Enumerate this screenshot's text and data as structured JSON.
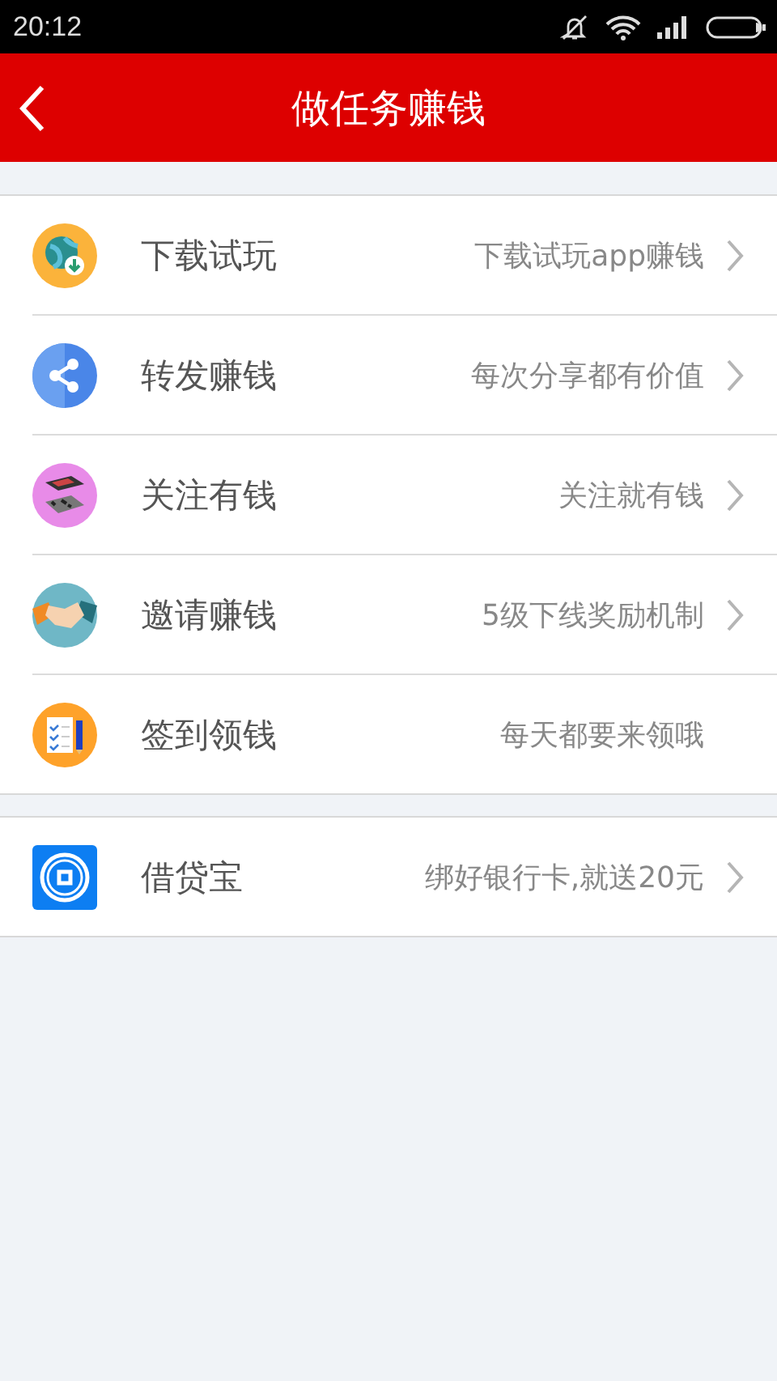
{
  "status_bar": {
    "time": "20:12"
  },
  "header": {
    "title": "做任务赚钱"
  },
  "sections": [
    {
      "items": [
        {
          "kind": "download",
          "label": "下载试玩",
          "detail": "下载试玩app赚钱",
          "has_arrow": true
        },
        {
          "kind": "share",
          "label": "转发赚钱",
          "detail": "每次分享都有价值",
          "has_arrow": true
        },
        {
          "kind": "follow",
          "label": "关注有钱",
          "detail": "关注就有钱",
          "has_arrow": true
        },
        {
          "kind": "invite",
          "label": "邀请赚钱",
          "detail": "5级下线奖励机制",
          "has_arrow": true
        },
        {
          "kind": "signin",
          "label": "签到领钱",
          "detail": "每天都要来领哦",
          "has_arrow": false
        }
      ]
    },
    {
      "items": [
        {
          "kind": "loan",
          "label": "借贷宝",
          "detail": "绑好银行卡,就送20元",
          "has_arrow": true
        }
      ]
    }
  ]
}
